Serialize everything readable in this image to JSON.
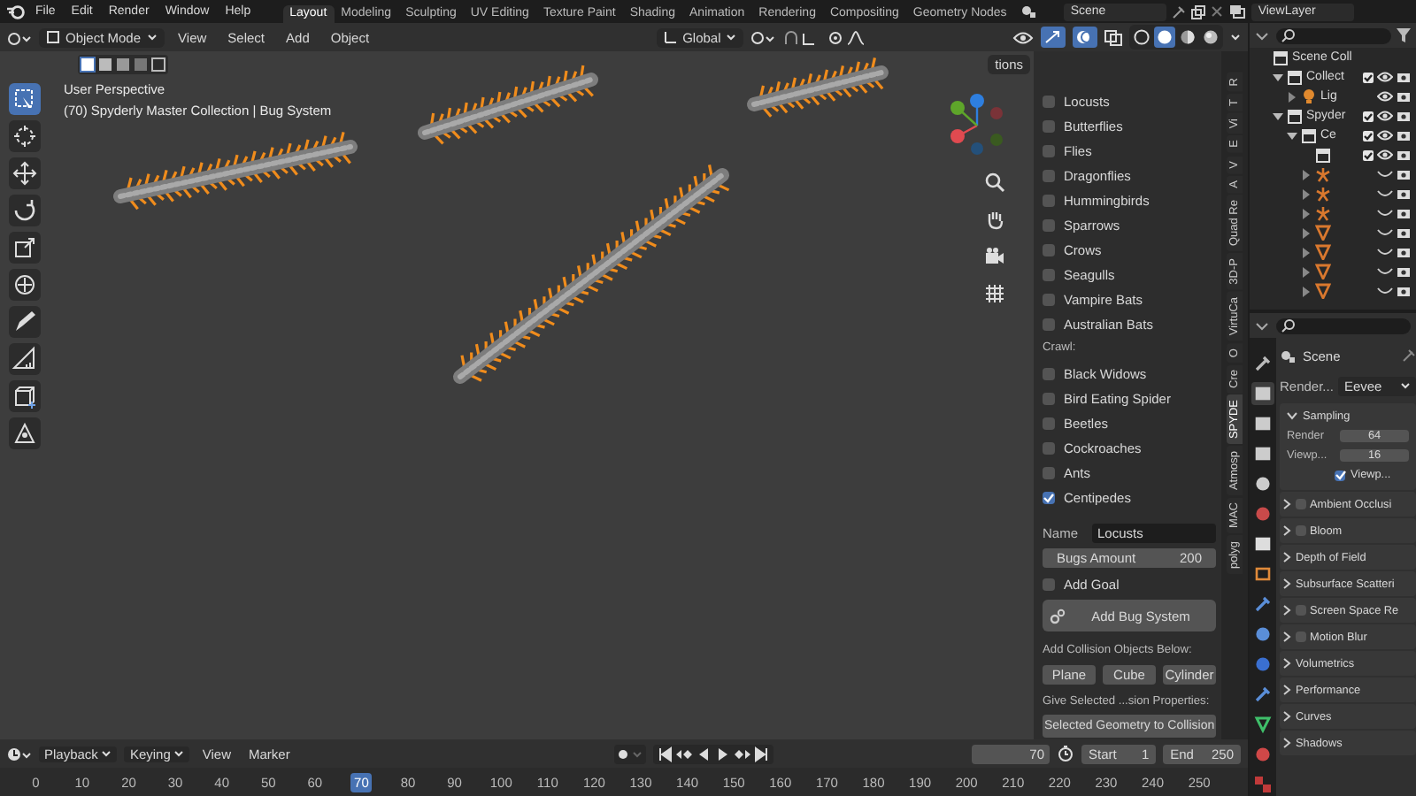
{
  "topbar": {
    "menus": [
      "File",
      "Edit",
      "Render",
      "Window",
      "Help"
    ],
    "workspaces": [
      {
        "label": "Layout",
        "selected": true
      },
      {
        "label": "Modeling",
        "selected": false
      },
      {
        "label": "Sculpting",
        "selected": false
      },
      {
        "label": "UV Editing",
        "selected": false
      },
      {
        "label": "Texture Paint",
        "selected": false
      },
      {
        "label": "Shading",
        "selected": false
      },
      {
        "label": "Animation",
        "selected": false
      },
      {
        "label": "Rendering",
        "selected": false
      },
      {
        "label": "Compositing",
        "selected": false
      },
      {
        "label": "Geometry Nodes",
        "selected": false
      }
    ],
    "scene": "Scene",
    "view_layer": "ViewLayer"
  },
  "viewport_header": {
    "mode": "Object Mode",
    "menus": [
      "View",
      "Select",
      "Add",
      "Object"
    ],
    "orientation": "Global",
    "shading_modes": [
      {
        "kind": "wireframe",
        "selected": false
      },
      {
        "kind": "solid",
        "selected": true
      },
      {
        "kind": "material",
        "selected": false
      },
      {
        "kind": "rendered",
        "selected": false
      }
    ]
  },
  "viewport": {
    "view_name": "User Perspective",
    "info": "(70) Spyderly Master Collection | Bug System",
    "options_label": "tions",
    "tools": [
      {
        "kind": "select",
        "selected": true
      },
      {
        "kind": "cursor",
        "selected": false
      },
      {
        "kind": "move",
        "selected": false
      },
      {
        "kind": "rotate",
        "selected": false
      },
      {
        "kind": "scale",
        "selected": false
      },
      {
        "kind": "transform",
        "selected": false
      },
      {
        "kind": "annotate",
        "selected": false
      },
      {
        "kind": "measure",
        "selected": false
      },
      {
        "kind": "add_cube",
        "selected": false
      },
      {
        "kind": "extra",
        "selected": false
      }
    ]
  },
  "bug_panel": {
    "fly_items": [
      {
        "label": "Locusts",
        "checked": false
      },
      {
        "label": "Butterflies",
        "checked": false
      },
      {
        "label": "Flies",
        "checked": false
      },
      {
        "label": "Dragonflies",
        "checked": false
      },
      {
        "label": "Hummingbirds",
        "checked": false
      },
      {
        "label": "Sparrows",
        "checked": false
      },
      {
        "label": "Crows",
        "checked": false
      },
      {
        "label": "Seagulls",
        "checked": false
      },
      {
        "label": "Vampire Bats",
        "checked": false
      },
      {
        "label": "Australian Bats",
        "checked": false
      }
    ],
    "crawl_heading": "Crawl:",
    "crawl_items": [
      {
        "label": "Black Widows",
        "checked": false
      },
      {
        "label": "Bird Eating Spider",
        "checked": false
      },
      {
        "label": "Beetles",
        "checked": false
      },
      {
        "label": "Cockroaches",
        "checked": false
      },
      {
        "label": "Ants",
        "checked": false
      },
      {
        "label": "Centipedes",
        "checked": true
      }
    ],
    "name_label": "Name",
    "name_value": "Locusts",
    "amount_label": "Bugs Amount",
    "amount_value": "200",
    "add_goal": {
      "label": "Add Goal",
      "checked": false
    },
    "add_button": "Add Bug System",
    "collision_heading": "Add Collision Objects Below:",
    "collision_buttons": [
      "Plane",
      "Cube",
      "Cylinder"
    ],
    "give_heading": "Give Selected ...sion Properties:",
    "selected_button": "Selected Geometry to Collision"
  },
  "side_tabs": [
    {
      "label": "R",
      "selected": false
    },
    {
      "label": "T",
      "selected": false
    },
    {
      "label": "Vi",
      "selected": false
    },
    {
      "label": "E",
      "selected": false
    },
    {
      "label": "V",
      "selected": false
    },
    {
      "label": "A",
      "selected": false
    },
    {
      "label": "Quad Re",
      "selected": false
    },
    {
      "label": "3D-P",
      "selected": false
    },
    {
      "label": "VirtuCa",
      "selected": false
    },
    {
      "label": "O",
      "selected": false
    },
    {
      "label": "Cre",
      "selected": false
    },
    {
      "label": "SPYDE",
      "selected": true
    },
    {
      "label": "Atmosp",
      "selected": false
    },
    {
      "label": "MAC",
      "selected": false
    },
    {
      "label": "polyg",
      "selected": false
    }
  ],
  "outliner": {
    "tree": [
      {
        "label": "Scene Coll",
        "kind": "scene",
        "children": [
          {
            "label": "Collect",
            "kind": "collection",
            "expanded": true,
            "checked": true,
            "visible": true,
            "children": [
              {
                "label": "Lig",
                "kind": "light",
                "expanded": false,
                "visible": true
              }
            ]
          },
          {
            "label": "Spyder",
            "kind": "collection",
            "expanded": true,
            "checked": true,
            "visible": true,
            "children": [
              {
                "label": "Ce",
                "kind": "collection",
                "expanded": true,
                "checked": true,
                "visible": true,
                "children": [
                  {
                    "kind": "collection",
                    "checked": true,
                    "visible": true
                  },
                  {
                    "kind": "armature",
                    "expanded": false,
                    "visible": false
                  },
                  {
                    "kind": "armature",
                    "expanded": false,
                    "visible": false
                  },
                  {
                    "kind": "armature",
                    "expanded": false,
                    "visible": false
                  },
                  {
                    "kind": "mesh",
                    "expanded": false,
                    "visible": false
                  },
                  {
                    "kind": "mesh",
                    "expanded": false,
                    "visible": false
                  },
                  {
                    "kind": "mesh",
                    "expanded": false,
                    "visible": false
                  },
                  {
                    "kind": "mesh",
                    "expanded": false,
                    "visible": false
                  }
                ]
              }
            ]
          }
        ]
      }
    ]
  },
  "properties": {
    "tabs": [
      {
        "kind": "tool",
        "selected": false
      },
      {
        "kind": "render",
        "selected": true
      },
      {
        "kind": "output",
        "selected": false
      },
      {
        "kind": "view_layer",
        "selected": false
      },
      {
        "kind": "scene",
        "selected": false
      },
      {
        "kind": "world",
        "selected": false
      },
      {
        "kind": "collection",
        "selected": false
      },
      {
        "kind": "object",
        "selected": false
      },
      {
        "kind": "modifiers",
        "selected": false
      },
      {
        "kind": "particles",
        "selected": false
      },
      {
        "kind": "physics",
        "selected": false
      },
      {
        "kind": "constraints",
        "selected": false
      },
      {
        "kind": "data",
        "selected": false
      },
      {
        "kind": "material",
        "selected": false
      },
      {
        "kind": "texture",
        "selected": false
      }
    ],
    "scene_name": "Scene",
    "engine_label": "Render...",
    "engine": "Eevee",
    "sampling": {
      "label": "Sampling",
      "expanded": true,
      "fields": [
        {
          "label": "Render",
          "value": "64"
        },
        {
          "label": "Viewp...",
          "value": "16"
        }
      ],
      "toggle": {
        "label": "Viewp...",
        "checked": true
      }
    },
    "sections": [
      {
        "label": "Ambient Occlusi",
        "checked": false
      },
      {
        "label": "Bloom",
        "checked": false
      },
      {
        "label": "Depth of Field"
      },
      {
        "label": "Subsurface Scatteri"
      },
      {
        "label": "Screen Space Re",
        "checked": false
      },
      {
        "label": "Motion Blur",
        "checked": false
      },
      {
        "label": "Volumetrics"
      },
      {
        "label": "Performance"
      },
      {
        "label": "Curves"
      },
      {
        "label": "Shadows"
      }
    ]
  },
  "timeline": {
    "menus": [
      {
        "label": "Playback",
        "dropdown": true
      },
      {
        "label": "Keying",
        "dropdown": true
      },
      {
        "label": "View",
        "dropdown": false
      },
      {
        "label": "Marker",
        "dropdown": false
      }
    ],
    "current_frame": "70",
    "start_label": "Start",
    "start": "1",
    "end_label": "End",
    "end": "250",
    "ruler": [
      {
        "label": "0",
        "current": false
      },
      {
        "label": "10",
        "current": false
      },
      {
        "label": "20",
        "current": false
      },
      {
        "label": "30",
        "current": false
      },
      {
        "label": "40",
        "current": false
      },
      {
        "label": "50",
        "current": false
      },
      {
        "label": "60",
        "current": false
      },
      {
        "label": "70",
        "current": true
      },
      {
        "label": "80",
        "current": false
      },
      {
        "label": "90",
        "current": false
      },
      {
        "label": "100",
        "current": false
      },
      {
        "label": "110",
        "current": false
      },
      {
        "label": "120",
        "current": false
      },
      {
        "label": "130",
        "current": false
      },
      {
        "label": "140",
        "current": false
      },
      {
        "label": "150",
        "current": false
      },
      {
        "label": "160",
        "current": false
      },
      {
        "label": "170",
        "current": false
      },
      {
        "label": "180",
        "current": false
      },
      {
        "label": "190",
        "current": false
      },
      {
        "label": "200",
        "current": false
      },
      {
        "label": "210",
        "current": false
      },
      {
        "label": "220",
        "current": false
      },
      {
        "label": "230",
        "current": false
      },
      {
        "label": "240",
        "current": false
      },
      {
        "label": "250",
        "current": false
      }
    ]
  }
}
